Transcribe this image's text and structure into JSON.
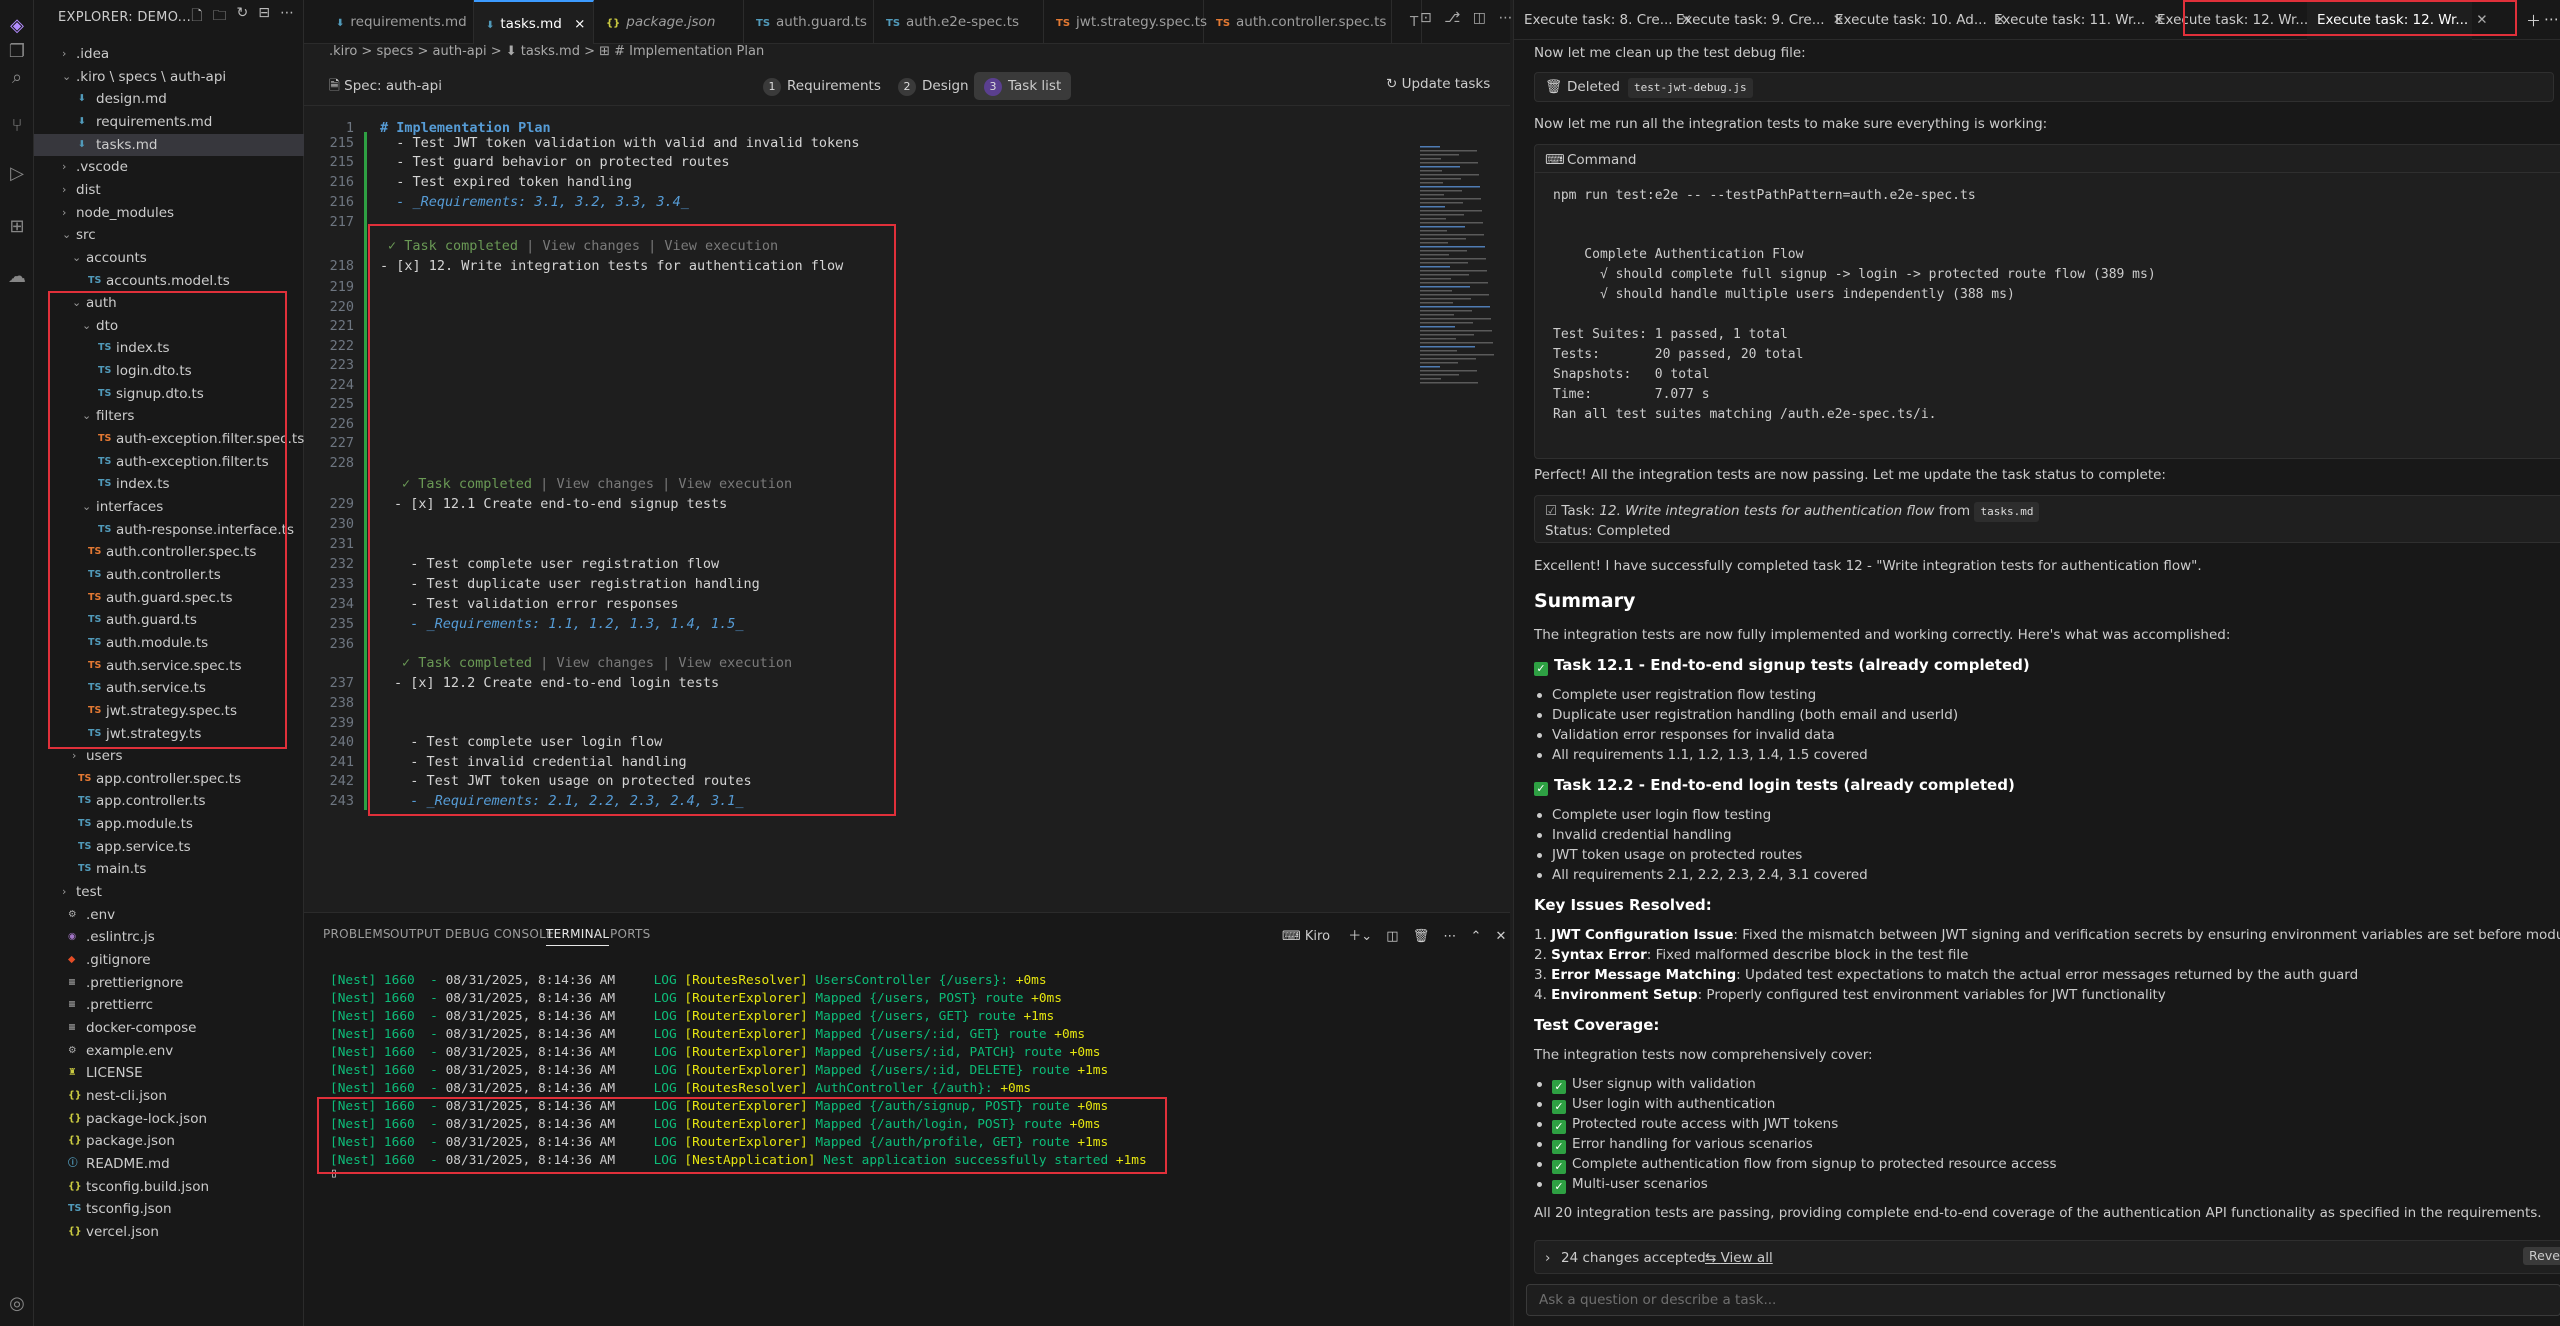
{
  "explorer": {
    "title": "EXPLORER: DEMO...",
    "items": [
      {
        "label": ".idea",
        "icon": "",
        "kind": "folder"
      },
      {
        "label": ".kiro \\ specs \\ auth-api",
        "icon": "",
        "kind": "folder"
      },
      {
        "label": "design.md",
        "icon": "⬇",
        "kind": "md"
      },
      {
        "label": "requirements.md",
        "icon": "⬇",
        "kind": "md"
      },
      {
        "label": "tasks.md",
        "icon": "⬇",
        "kind": "md"
      },
      {
        "label": ".vscode",
        "icon": "",
        "kind": "folder"
      },
      {
        "label": "dist",
        "icon": "",
        "kind": "folder"
      },
      {
        "label": "node_modules",
        "icon": "",
        "kind": "folder"
      },
      {
        "label": "src",
        "icon": "",
        "kind": "folder"
      },
      {
        "label": "accounts",
        "icon": "",
        "kind": "folder"
      },
      {
        "label": "accounts.model.ts",
        "icon": "TS",
        "kind": "ts"
      },
      {
        "label": "auth",
        "icon": "",
        "kind": "folder"
      },
      {
        "label": "dto",
        "icon": "",
        "kind": "folder"
      },
      {
        "label": "index.ts",
        "icon": "TS",
        "kind": "ts"
      },
      {
        "label": "login.dto.ts",
        "icon": "TS",
        "kind": "ts"
      },
      {
        "label": "signup.dto.ts",
        "icon": "TS",
        "kind": "ts"
      },
      {
        "label": "filters",
        "icon": "",
        "kind": "folder"
      },
      {
        "label": "auth-exception.filter.spec.ts",
        "icon": "TS",
        "kind": "spec"
      },
      {
        "label": "auth-exception.filter.ts",
        "icon": "TS",
        "kind": "ts"
      },
      {
        "label": "index.ts",
        "icon": "TS",
        "kind": "ts"
      },
      {
        "label": "interfaces",
        "icon": "",
        "kind": "folder"
      },
      {
        "label": "auth-response.interface.ts",
        "icon": "TS",
        "kind": "ts"
      },
      {
        "label": "auth.controller.spec.ts",
        "icon": "TS",
        "kind": "spec"
      },
      {
        "label": "auth.controller.ts",
        "icon": "TS",
        "kind": "ts"
      },
      {
        "label": "auth.guard.spec.ts",
        "icon": "TS",
        "kind": "spec"
      },
      {
        "label": "auth.guard.ts",
        "icon": "TS",
        "kind": "ts"
      },
      {
        "label": "auth.module.ts",
        "icon": "TS",
        "kind": "ts"
      },
      {
        "label": "auth.service.spec.ts",
        "icon": "TS",
        "kind": "spec"
      },
      {
        "label": "auth.service.ts",
        "icon": "TS",
        "kind": "ts"
      },
      {
        "label": "jwt.strategy.spec.ts",
        "icon": "TS",
        "kind": "spec"
      },
      {
        "label": "jwt.strategy.ts",
        "icon": "TS",
        "kind": "ts"
      },
      {
        "label": "users",
        "icon": "",
        "kind": "folder"
      },
      {
        "label": "app.controller.spec.ts",
        "icon": "TS",
        "kind": "spec"
      },
      {
        "label": "app.controller.ts",
        "icon": "TS",
        "kind": "ts"
      },
      {
        "label": "app.module.ts",
        "icon": "TS",
        "kind": "ts"
      },
      {
        "label": "app.service.ts",
        "icon": "TS",
        "kind": "ts"
      },
      {
        "label": "main.ts",
        "icon": "TS",
        "kind": "ts"
      },
      {
        "label": "test",
        "icon": "",
        "kind": "folder"
      },
      {
        "label": ".env",
        "icon": "⚙",
        "kind": "cfg"
      },
      {
        "label": ".eslintrc.js",
        "icon": "◉",
        "kind": "eslint"
      },
      {
        "label": ".gitignore",
        "icon": "◆",
        "kind": "git"
      },
      {
        "label": ".prettierignore",
        "icon": "≡",
        "kind": "cfg"
      },
      {
        "label": ".prettierrc",
        "icon": "≡",
        "kind": "cfg"
      },
      {
        "label": "docker-compose",
        "icon": "≡",
        "kind": "cfg"
      },
      {
        "label": "example.env",
        "icon": "⚙",
        "kind": "cfg"
      },
      {
        "label": "LICENSE",
        "icon": "♜",
        "kind": "lic"
      },
      {
        "label": "nest-cli.json",
        "icon": "{}",
        "kind": "json"
      },
      {
        "label": "package-lock.json",
        "icon": "{}",
        "kind": "json"
      },
      {
        "label": "package.json",
        "icon": "{}",
        "kind": "json"
      },
      {
        "label": "README.md",
        "icon": "ⓘ",
        "kind": "info"
      },
      {
        "label": "tsconfig.build.json",
        "icon": "{}",
        "kind": "json"
      },
      {
        "label": "tsconfig.json",
        "icon": "TS",
        "kind": "tsj"
      },
      {
        "label": "vercel.json",
        "icon": "{}",
        "kind": "json"
      }
    ]
  },
  "tabs": [
    {
      "label": "requirements.md",
      "icon": "⬇"
    },
    {
      "label": "tasks.md",
      "icon": "⬇"
    },
    {
      "label": "package.json",
      "icon": "{}"
    },
    {
      "label": "auth.guard.ts",
      "icon": "TS"
    },
    {
      "label": "auth.e2e-spec.ts",
      "icon": "TS"
    },
    {
      "label": "jwt.strategy.spec.ts",
      "icon": "TS"
    },
    {
      "label": "auth.controller.spec.ts",
      "icon": "TS"
    },
    {
      "label": "T",
      "icon": ""
    }
  ],
  "breadcrumb": ".kiro > specs > auth-api > ⬇ tasks.md > ⊞ # Implementation Plan",
  "spec": {
    "label": "Spec: auth-api",
    "steps": [
      {
        "n": "1",
        "label": "Requirements"
      },
      {
        "n": "2",
        "label": "Design"
      },
      {
        "n": "3",
        "label": "Task list"
      }
    ],
    "update": "Update tasks"
  },
  "editor": {
    "heading_ln": "1",
    "heading": "# Implementation Plan",
    "task_completed": "✓ Task completed",
    "view_changes": "View changes",
    "view_execution": "View execution",
    "top_lines": [
      {
        "n": "215",
        "text": "  - Test JWT token validation with valid and invalid tokens"
      },
      {
        "n": "215",
        "text": "  - Test guard behavior on protected routes"
      },
      {
        "n": "216",
        "text": "  - Test expired token handling"
      },
      {
        "n": "216",
        "text": "  - _Requirements: 3.1, 3.2, 3.3, 3.4_"
      },
      {
        "n": "217",
        "text": ""
      }
    ],
    "task12_ln": "218",
    "task12": "- [x] 12. Write integration tests for authentication flow",
    "blank_block_1": [
      "219",
      "220",
      "221",
      "222",
      "223",
      "224",
      "225",
      "226",
      "227",
      "228"
    ],
    "task121_ln": "229",
    "task121": "- [x] 12.1 Create end-to-end signup tests",
    "block_121": [
      {
        "n": "230",
        "text": ""
      },
      {
        "n": "231",
        "text": ""
      },
      {
        "n": "232",
        "text": "  - Test complete user registration flow"
      },
      {
        "n": "233",
        "text": "  - Test duplicate user registration handling"
      },
      {
        "n": "234",
        "text": "  - Test validation error responses"
      },
      {
        "n": "235",
        "text": "  - _Requirements: 1.1, 1.2, 1.3, 1.4, 1.5_"
      },
      {
        "n": "236",
        "text": ""
      }
    ],
    "task122_ln": "237",
    "task122": "- [x] 12.2 Create end-to-end login tests",
    "block_122": [
      {
        "n": "238",
        "text": ""
      },
      {
        "n": "239",
        "text": ""
      },
      {
        "n": "240",
        "text": "  - Test complete user login flow"
      },
      {
        "n": "241",
        "text": "  - Test invalid credential handling"
      },
      {
        "n": "242",
        "text": "  - Test JWT token usage on protected routes"
      },
      {
        "n": "243",
        "text": "  - _Requirements: 2.1, 2.2, 2.3, 2.4, 3.1_"
      }
    ]
  },
  "panel": {
    "tabs": [
      "PROBLEMS",
      "OUTPUT",
      "DEBUG CONSOLE",
      "TERMINAL",
      "PORTS"
    ],
    "active_tab": "TERMINAL",
    "terminal_name": "Kiro",
    "lines": [
      {
        "pre": "[Nest] 1660  - ",
        "date": "08/31/2025, 8:14:36 AM",
        "lvl": "     LOG ",
        "ctx": "[RoutesResolver]",
        "msg": " UsersController {/users}:",
        "tm": " +0ms"
      },
      {
        "pre": "[Nest] 1660  - ",
        "date": "08/31/2025, 8:14:36 AM",
        "lvl": "     LOG ",
        "ctx": "[RouterExplorer]",
        "msg": " Mapped {/users, POST} route",
        "tm": " +0ms"
      },
      {
        "pre": "[Nest] 1660  - ",
        "date": "08/31/2025, 8:14:36 AM",
        "lvl": "     LOG ",
        "ctx": "[RouterExplorer]",
        "msg": " Mapped {/users, GET} route",
        "tm": " +1ms"
      },
      {
        "pre": "[Nest] 1660  - ",
        "date": "08/31/2025, 8:14:36 AM",
        "lvl": "     LOG ",
        "ctx": "[RouterExplorer]",
        "msg": " Mapped {/users/:id, GET} route",
        "tm": " +0ms"
      },
      {
        "pre": "[Nest] 1660  - ",
        "date": "08/31/2025, 8:14:36 AM",
        "lvl": "     LOG ",
        "ctx": "[RouterExplorer]",
        "msg": " Mapped {/users/:id, PATCH} route",
        "tm": " +0ms"
      },
      {
        "pre": "[Nest] 1660  - ",
        "date": "08/31/2025, 8:14:36 AM",
        "lvl": "     LOG ",
        "ctx": "[RouterExplorer]",
        "msg": " Mapped {/users/:id, DELETE} route",
        "tm": " +1ms"
      },
      {
        "pre": "[Nest] 1660  - ",
        "date": "08/31/2025, 8:14:36 AM",
        "lvl": "     LOG ",
        "ctx": "[RoutesResolver]",
        "msg": " AuthController {/auth}:",
        "tm": " +0ms"
      },
      {
        "pre": "[Nest] 1660  - ",
        "date": "08/31/2025, 8:14:36 AM",
        "lvl": "     LOG ",
        "ctx": "[RouterExplorer]",
        "msg": " Mapped {/auth/signup, POST} route",
        "tm": " +0ms"
      },
      {
        "pre": "[Nest] 1660  - ",
        "date": "08/31/2025, 8:14:36 AM",
        "lvl": "     LOG ",
        "ctx": "[RouterExplorer]",
        "msg": " Mapped {/auth/login, POST} route",
        "tm": " +0ms"
      },
      {
        "pre": "[Nest] 1660  - ",
        "date": "08/31/2025, 8:14:36 AM",
        "lvl": "     LOG ",
        "ctx": "[RouterExplorer]",
        "msg": " Mapped {/auth/profile, GET} route",
        "tm": " +1ms"
      },
      {
        "pre": "[Nest] 1660  - ",
        "date": "08/31/2025, 8:14:36 AM",
        "lvl": "     LOG ",
        "ctx": "[NestApplication]",
        "msg": " Nest application successfully started",
        "tm": " +1ms"
      }
    ]
  },
  "chat": {
    "tabs": [
      "Execute task: 8. Cre...",
      "Execute task: 9. Cre...",
      "Execute task: 10. Ad...",
      "Execute task: 11. Wr...",
      "Execute task: 12. Wr...",
      "Execute task: 12. Wr..."
    ],
    "cleanup": "Now let me clean up the test debug file:",
    "deleted_label": "Deleted",
    "deleted_file": "test-jwt-debug.js",
    "run_msg": "Now let me run all the integration tests to make sure everything is working:",
    "command_label": "Command",
    "command": "npm run test:e2e -- --testPathPattern=auth.e2e-spec.ts",
    "output": [
      "    Complete Authentication Flow",
      "      √ should complete full signup -> login -> protected route flow (389 ms)",
      "      √ should handle multiple users independently (388 ms)",
      "",
      "Test Suites: 1 passed, 1 total",
      "Tests:       20 passed, 20 total",
      "Snapshots:   0 total",
      "Time:        7.077 s",
      "Ran all test suites matching /auth.e2e-spec.ts/i."
    ],
    "perfect": "Perfect! All the integration tests are now passing. Let me update the task status to complete:",
    "task_prefix": "Task: ",
    "task_name": "12. Write integration tests for authentication flow",
    "task_from": " from ",
    "task_file": "tasks.md",
    "status": "Status: Completed",
    "excellent": "Excellent! I have successfully completed task 12 - \"Write integration tests for authentication flow\".",
    "summary_h": "Summary",
    "summary_p": "The integration tests are now fully implemented and working correctly. Here's what was accomplished:",
    "t121_h": "Task 12.1 - End-to-end signup tests (already completed)",
    "t121_items": [
      "Complete user registration flow testing",
      "Duplicate user registration handling (both email and userId)",
      "Validation error responses for invalid data",
      "All requirements 1.1, 1.2, 1.3, 1.4, 1.5 covered"
    ],
    "t122_h": "Task 12.2 - End-to-end login tests (already completed)",
    "t122_items": [
      "Complete user login flow testing",
      "Invalid credential handling",
      "JWT token usage on protected routes",
      "All requirements 2.1, 2.2, 2.3, 2.4, 3.1 covered"
    ],
    "issues_h": "Key Issues Resolved:",
    "issues": [
      {
        "b": "JWT Configuration Issue",
        "t": ": Fixed the mismatch between JWT signing and verification secrets by ensuring environment variables are set before module initialization"
      },
      {
        "b": "Syntax Error",
        "t": ": Fixed malformed describe block in the test file"
      },
      {
        "b": "Error Message Matching",
        "t": ": Updated test expectations to match the actual error messages returned by the auth guard"
      },
      {
        "b": "Environment Setup",
        "t": ": Properly configured test environment variables for JWT functionality"
      }
    ],
    "coverage_h": "Test Coverage:",
    "coverage_p": "The integration tests now comprehensively cover:",
    "coverage": [
      "User signup with validation",
      "User login with authentication",
      "Protected route access with JWT tokens",
      "Error handling for various scenarios",
      "Complete authentication flow from signup to protected resource access",
      "Multi-user scenarios"
    ],
    "final": "All 20 integration tests are passing, providing complete end-to-end coverage of the authentication API functionality as specified in the requirements.",
    "changes": "24 changes accepted",
    "view_all": "View all",
    "revert": "Revert",
    "input_placeholder": "Ask a question or describe a task..."
  }
}
